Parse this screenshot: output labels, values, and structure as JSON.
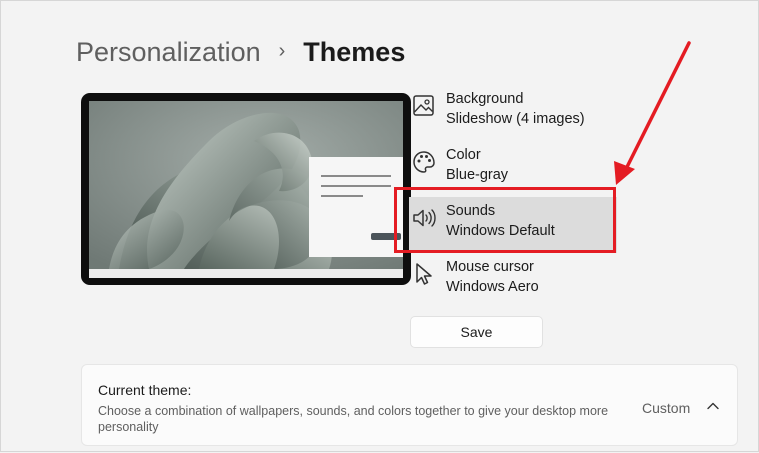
{
  "breadcrumb": {
    "parent": "Personalization",
    "separator": "›",
    "current": "Themes"
  },
  "theme_options": [
    {
      "icon": "picture-icon",
      "label": "Background",
      "value": "Slideshow (4 images)"
    },
    {
      "icon": "palette-icon",
      "label": "Color",
      "value": "Blue-gray"
    },
    {
      "icon": "speaker-icon",
      "label": "Sounds",
      "value": "Windows Default"
    },
    {
      "icon": "mouse-cursor-icon",
      "label": "Mouse cursor",
      "value": "Windows Aero"
    }
  ],
  "save_button": "Save",
  "current_theme": {
    "title": "Current theme:",
    "description": "Choose a combination of wallpapers, sounds, and colors together to give your desktop more personality",
    "value": "Custom"
  },
  "colors": {
    "annotation": "#e41c23",
    "highlight": "#dcdcdc"
  }
}
